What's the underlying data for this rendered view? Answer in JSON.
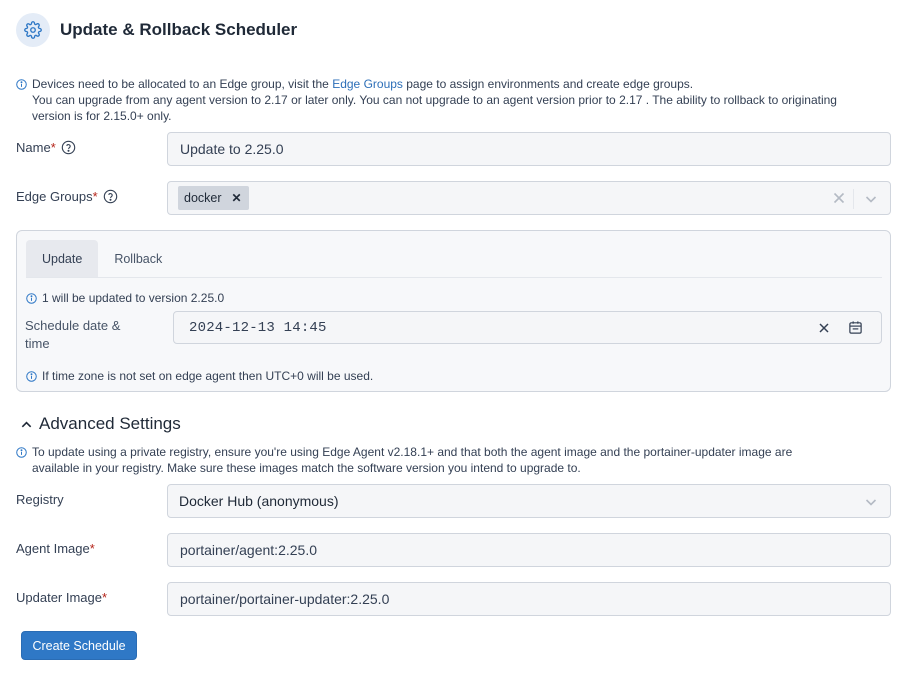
{
  "header": {
    "title": "Update & Rollback Scheduler",
    "icon": "gear-icon"
  },
  "notice": {
    "line1_prefix": "Devices need to be allocated to an Edge group, visit the ",
    "link": "Edge Groups",
    "line1_suffix": " page to assign environments and create edge groups.",
    "line2": "You can upgrade from any agent version to 2.17 or later only. You can not upgrade to an agent version prior to 2.17 . The ability to rollback to originating",
    "line3": "version is for 2.15.0+ only."
  },
  "form": {
    "name_label": "Name",
    "name_value": "Update to 2.25.0",
    "edge_groups_label": "Edge Groups",
    "edge_groups_selected": [
      "docker"
    ],
    "required_mark": "*"
  },
  "schedule_panel": {
    "tabs": [
      "Update",
      "Rollback"
    ],
    "active_tab": "Update",
    "update_info": "1 will be updated to version 2.25.0",
    "datetime_label": "Schedule date & time",
    "datetime_value": "2024-12-13 14:45",
    "timezone_info": "If time zone is not set on edge agent then UTC+0 will be used."
  },
  "advanced": {
    "title": "Advanced Settings",
    "info_line1": "To update using a private registry, ensure you're using Edge Agent v2.18.1+ and that both the agent image and the portainer-updater image are",
    "info_line2": "available in your registry. Make sure these images match the software version you intend to upgrade to.",
    "registry_label": "Registry",
    "registry_value": "Docker Hub (anonymous)",
    "agent_image_label": "Agent Image",
    "agent_image_value": "portainer/agent:2.25.0",
    "updater_image_label": "Updater Image",
    "updater_image_value": "portainer/portainer-updater:2.25.0"
  },
  "actions": {
    "create_label": "Create Schedule"
  },
  "colors": {
    "accent": "#2f78c6",
    "link": "#2d6fb8",
    "required": "#b42318",
    "header_icon_bg": "#e4ecf7"
  }
}
